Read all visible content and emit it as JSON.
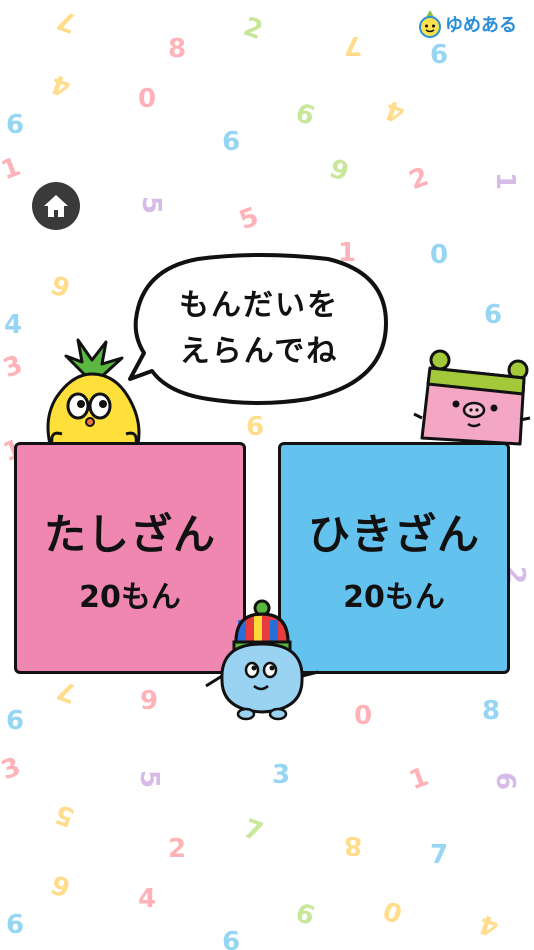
{
  "app": {
    "logo_text": "ゆめある"
  },
  "navigation": {
    "home_icon": "home-icon"
  },
  "prompt": {
    "line1": "もんだいを",
    "line2": "えらんでね"
  },
  "modes": [
    {
      "title": "たしざん",
      "count": "20もん",
      "color": "#ef87b0"
    },
    {
      "title": "ひきざん",
      "count": "20もん",
      "color": "#63c3ee"
    }
  ],
  "background_digits": [
    "7",
    "2",
    "8",
    "7",
    "6",
    "4",
    "0",
    "6",
    "9",
    "4",
    "6",
    "1",
    "9",
    "2",
    "1",
    "5",
    "5",
    "1",
    "0",
    "6",
    "4",
    "6",
    "3",
    "6",
    "1",
    "2",
    "7",
    "9",
    "6",
    "0",
    "8",
    "3",
    "6",
    "5",
    "3",
    "1",
    "5",
    "7",
    "2",
    "8",
    "7",
    "6",
    "4",
    "0",
    "6",
    "6",
    "9",
    "4"
  ]
}
